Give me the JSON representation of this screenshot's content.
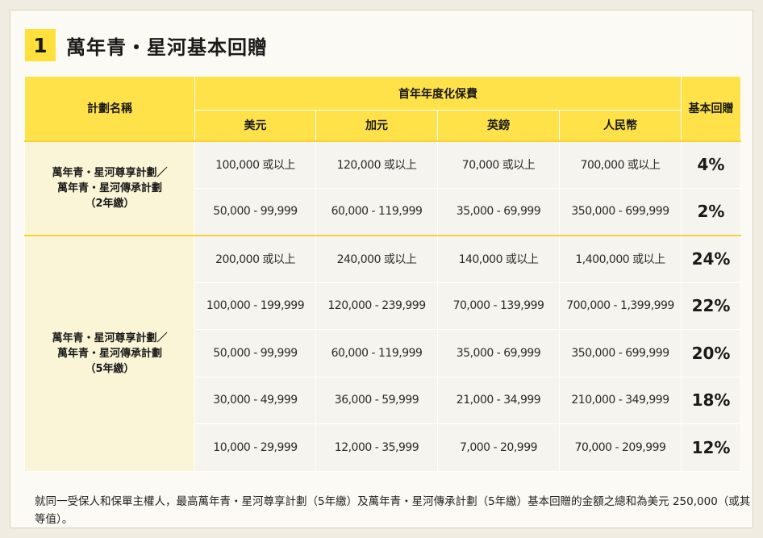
{
  "title": {
    "number": "1",
    "text": "萬年青・星河基本回贈"
  },
  "table": {
    "col_plan": "計劃名稱",
    "col_premium_group": "首年年度化保費",
    "col_rebate": "基本回贈",
    "currencies": [
      "美元",
      "加元",
      "英鎊",
      "人民幣"
    ],
    "groups": [
      {
        "plan_lines": [
          "萬年青・星河尊享計劃／",
          "萬年青・星河傳承計劃",
          "（2年繳）"
        ],
        "rows": [
          {
            "values": [
              "100,000 或以上",
              "120,000 或以上",
              "70,000 或以上",
              "700,000 或以上"
            ],
            "rebate": "4%"
          },
          {
            "values": [
              "50,000 - 99,999",
              "60,000 - 119,999",
              "35,000 - 69,999",
              "350,000 - 699,999"
            ],
            "rebate": "2%"
          }
        ]
      },
      {
        "plan_lines": [
          "萬年青・星河尊享計劃／",
          "萬年青・星河傳承計劃",
          "（5年繳）"
        ],
        "rows": [
          {
            "values": [
              "200,000 或以上",
              "240,000 或以上",
              "140,000 或以上",
              "1,400,000 或以上"
            ],
            "rebate": "24%"
          },
          {
            "values": [
              "100,000 - 199,999",
              "120,000 - 239,999",
              "70,000 - 139,999",
              "700,000 - 1,399,999"
            ],
            "rebate": "22%"
          },
          {
            "values": [
              "50,000 - 99,999",
              "60,000 - 119,999",
              "35,000 - 69,999",
              "350,000 - 699,999"
            ],
            "rebate": "20%"
          },
          {
            "values": [
              "30,000 - 49,999",
              "36,000 - 59,999",
              "21,000 - 34,999",
              "210,000 - 349,999"
            ],
            "rebate": "18%"
          },
          {
            "values": [
              "10,000 - 29,999",
              "12,000 - 35,999",
              "7,000 - 20,999",
              "70,000 - 209,999"
            ],
            "rebate": "12%"
          }
        ]
      }
    ]
  },
  "note": "就同一受保人和保單主權人，最高萬年青・星河尊享計劃（5年繳）及萬年青・星河傳承計劃（5年繳）基本回贈的金額之總和為美元 250,000（或其等值）。",
  "colors": {
    "accent_yellow": "#ffe24a",
    "badge_yellow": "#ffe03c",
    "plan_cell": "#fbf5d7",
    "value_cell": "#f6f4ee"
  }
}
